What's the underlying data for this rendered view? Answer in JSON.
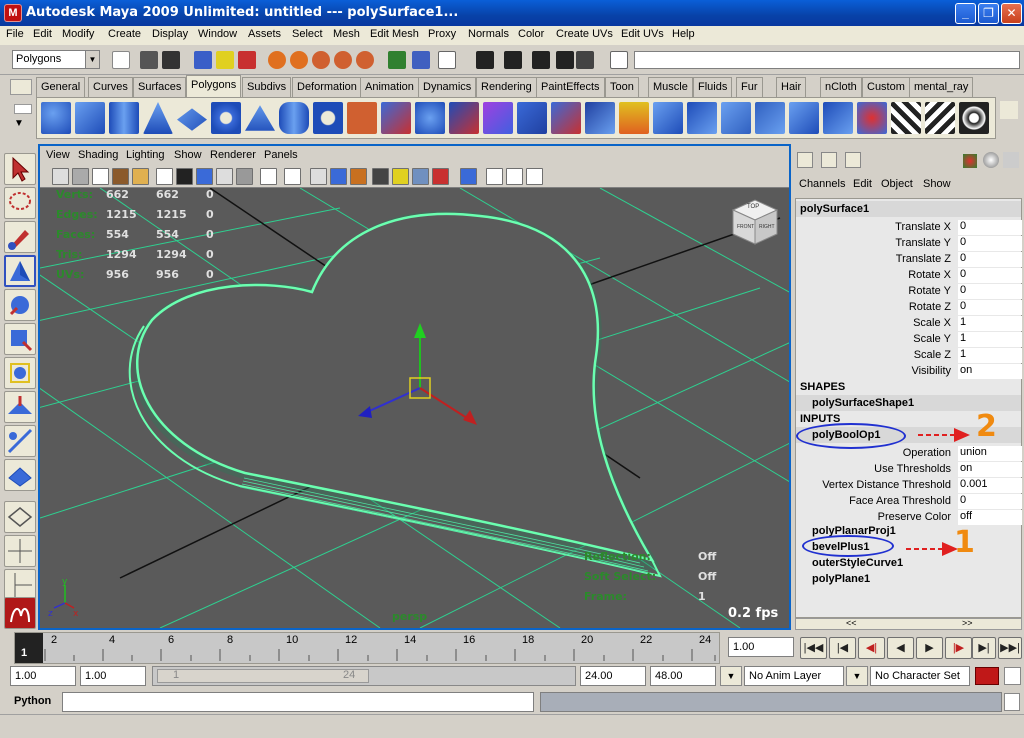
{
  "window": {
    "title": "Autodesk Maya 2009 Unlimited: untitled   ---   polySurface1..."
  },
  "menubar": [
    "File",
    "Edit",
    "Modify",
    "Create",
    "Display",
    "Window",
    "Assets",
    "Select",
    "Mesh",
    "Edit Mesh",
    "Proxy",
    "Normals",
    "Color",
    "Create UVs",
    "Edit UVs",
    "Help"
  ],
  "statusline": {
    "mode": "Polygons"
  },
  "shelf": {
    "tabs": [
      "General",
      "Curves",
      "Surfaces",
      "Polygons",
      "Subdivs",
      "Deformation",
      "Animation",
      "Dynamics",
      "Rendering",
      "PaintEffects",
      "Toon",
      "Muscle",
      "Fluids",
      "Fur",
      "Hair",
      "nCloth",
      "Custom",
      "mental_ray"
    ],
    "active_tab": "Polygons"
  },
  "viewport": {
    "menu": [
      "View",
      "Shading",
      "Lighting",
      "Show",
      "Renderer",
      "Panels"
    ],
    "hud": {
      "rows": [
        {
          "label": "Verts:",
          "a": "662",
          "b": "662",
          "c": "0"
        },
        {
          "label": "Edges:",
          "a": "1215",
          "b": "1215",
          "c": "0"
        },
        {
          "label": "Faces:",
          "a": "554",
          "b": "554",
          "c": "0"
        },
        {
          "label": "Tris:",
          "a": "1294",
          "b": "1294",
          "c": "0"
        },
        {
          "label": "UVs:",
          "a": "956",
          "b": "956",
          "c": "0"
        }
      ],
      "reflection_label": "Reflection:",
      "reflection_value": "Off",
      "softselect_label": "Soft Select:",
      "softselect_value": "Off",
      "frame_label": "Frame:",
      "frame_value": "1",
      "camera": "persp",
      "fps": "0.2 fps"
    },
    "viewcube": {
      "top": "TOP",
      "front": "FRONT",
      "right": "RIGHT"
    }
  },
  "channelbox": {
    "menu": [
      "Channels",
      "Edit",
      "Object",
      "Show"
    ],
    "object": "polySurface1",
    "attributes": [
      {
        "name": "Translate X",
        "value": "0"
      },
      {
        "name": "Translate Y",
        "value": "0"
      },
      {
        "name": "Translate Z",
        "value": "0"
      },
      {
        "name": "Rotate X",
        "value": "0"
      },
      {
        "name": "Rotate Y",
        "value": "0"
      },
      {
        "name": "Rotate Z",
        "value": "0"
      },
      {
        "name": "Scale X",
        "value": "1"
      },
      {
        "name": "Scale Y",
        "value": "1"
      },
      {
        "name": "Scale Z",
        "value": "1"
      },
      {
        "name": "Visibility",
        "value": "on"
      }
    ],
    "shapes_header": "SHAPES",
    "shape_node": "polySurfaceShape1",
    "inputs_header": "INPUTS",
    "bool_node": "polyBoolOp1",
    "bool_attributes": [
      {
        "name": "Operation",
        "value": "union"
      },
      {
        "name": "Use Thresholds",
        "value": "on"
      },
      {
        "name": "Vertex Distance Threshold",
        "value": "0.001"
      },
      {
        "name": "Face Area Threshold",
        "value": "0"
      },
      {
        "name": "Preserve Color",
        "value": "off"
      }
    ],
    "history_nodes": [
      "polyPlanarProj1",
      "bevelPlus1",
      "outerStyleCurve1",
      "polyPlane1"
    ],
    "annotations": {
      "one": "1",
      "two": "2"
    },
    "scroll_left": "<<",
    "scroll_right": ">>"
  },
  "timeslider": {
    "current_frame": "1",
    "ticks": [
      "2",
      "4",
      "6",
      "8",
      "10",
      "12",
      "14",
      "16",
      "18",
      "20",
      "22",
      "24"
    ],
    "current_time_field": "1.00"
  },
  "rangeslider": {
    "start": "1.00",
    "playback_start": "1.00",
    "range_start_label": "1",
    "range_end_label": "24",
    "playback_end": "24.00",
    "end": "48.00",
    "anim_layer": "No Anim Layer",
    "character_set": "No Character Set"
  },
  "cmdline": {
    "label": "Python"
  },
  "colors": {
    "accent": "#0a64c8",
    "mesh": "#4fffa8",
    "viewport_bg": "#5a5a5a",
    "hud": "#2b8a2b"
  }
}
